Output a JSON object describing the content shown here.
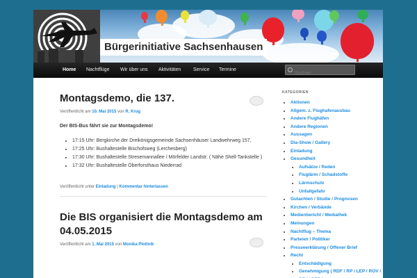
{
  "site": {
    "logo_word1": "Bürgerinitiative",
    "logo_word2": "Sachsenhausen"
  },
  "nav": {
    "items": [
      "Home",
      "Nachtflüge",
      "Wir über uns",
      "Aktivitäten",
      "Service",
      "Termine"
    ],
    "search_placeholder": "Suchen"
  },
  "posts": [
    {
      "title": "Montagsdemo, die 137.",
      "meta_prefix": "Veröffentlicht am",
      "date": "10. Mai 2015",
      "meta_by": "von",
      "author": "R. Krug",
      "lead": "Der BIS-Bus fährt sie zur Montagsdemo!",
      "bullets": [
        "17:15 Uhr: Bergkirche der Dreikönigsgemeinde Sachsenhäuser Landwehrweg 157,",
        "17:25 Uhr: Bushaltestelle Bischofsweg (Lerchesberg)",
        "17:30 Uhr: Bushaltestelle Stresemannallee / Mörfelder Landstr. ( Nähe Shell-Tankstelle )",
        "17:32 Uhr: Bushaltestelle Oberforsthaus Niederrad"
      ],
      "footer_prefix": "Veröffentlicht unter",
      "category": "Einladung",
      "footer_sep": "|",
      "comment_link": "Kommentar hinterlassen"
    },
    {
      "title": "Die BIS organisiert die Montagsdemo am 04.05.2015",
      "meta_prefix": "Veröffentlicht am",
      "date": "1. Mai 2015",
      "meta_by": "von",
      "author": "Monika Plottnik"
    }
  ],
  "sidebar": {
    "title": "KATEGORIEN",
    "categories": [
      "Aktionen",
      "Allgem. z. Flughafenausbau",
      "Andere Flughäfen",
      "Andere Regionen",
      "Aussagen",
      "Dia-Show / Gallery",
      "Einladung",
      "Gesundheit"
    ],
    "sub_gesundheit": [
      "Aufsätze / Reden",
      "Fluglärm / Schadstoffe",
      "Lärmschutz",
      "Unfallgefahr"
    ],
    "categories2": [
      "Gutachten / Studie / Prognosen",
      "Kirchen / Verbände",
      "Medienbericht / Mediathek",
      "Meinungen",
      "Nachtflug – Thema",
      "Parteien / Politiker",
      "Presseerklärung / Offener Brief",
      "Recht"
    ],
    "sub_recht": [
      "Entschädigung",
      "Genehmigung ( RDF / RP / LEP / ROV / PFV / PFB )"
    ]
  },
  "colors": {
    "background": "#1e6f8f",
    "link": "#1b8be0",
    "navbar": "#111111"
  }
}
